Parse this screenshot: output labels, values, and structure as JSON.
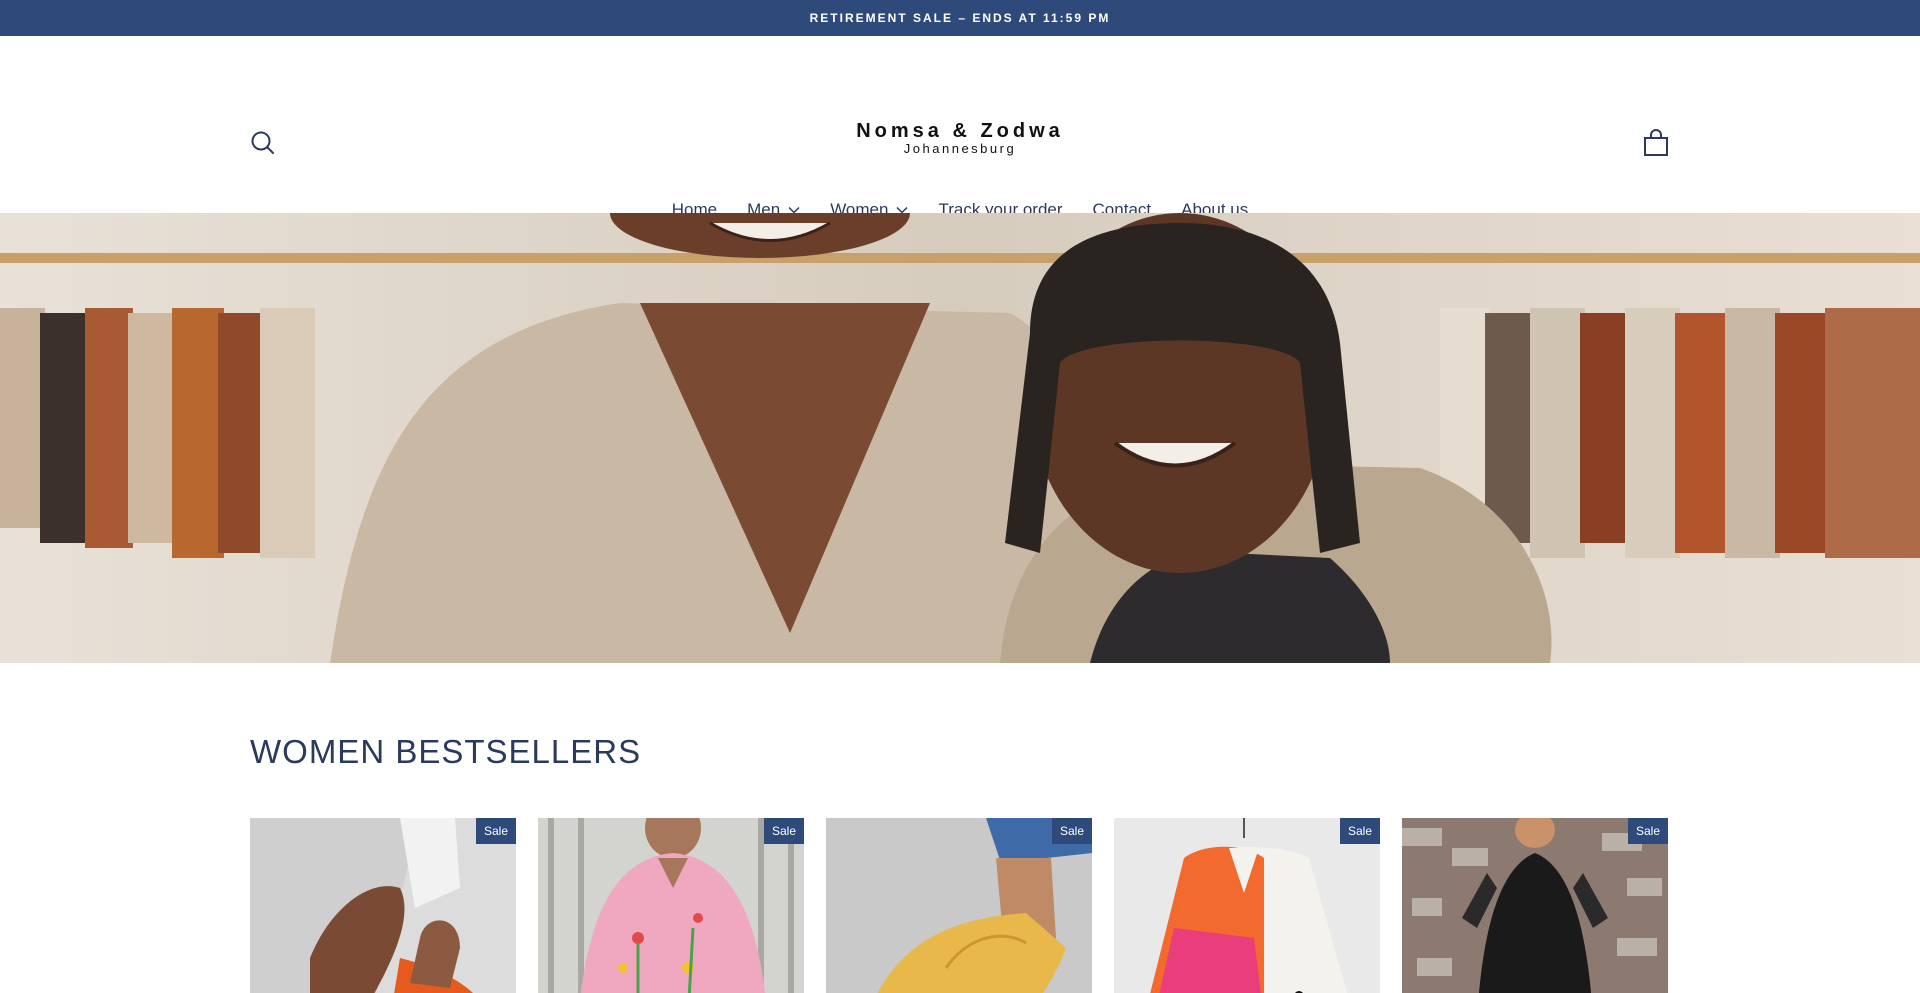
{
  "announcement": {
    "text": "RETIREMENT SALE – ENDS AT 11:59 PM"
  },
  "header": {
    "logo_name": "Nomsa & Zodwa",
    "logo_city": "Johannesburg",
    "search_icon": "search-icon",
    "cart_icon": "shopping-bag-icon"
  },
  "nav": {
    "items": [
      {
        "label": "Home"
      },
      {
        "label": "Men",
        "has_dropdown": true
      },
      {
        "label": "Women",
        "has_dropdown": true
      },
      {
        "label": "Track your order"
      },
      {
        "label": "Contact"
      },
      {
        "label": "About us"
      }
    ]
  },
  "section": {
    "title": "WOMEN BESTSELLERS"
  },
  "products": [
    {
      "badge": "Sale"
    },
    {
      "badge": "Sale"
    },
    {
      "badge": "Sale"
    },
    {
      "badge": "Sale"
    },
    {
      "badge": "Sale"
    }
  ],
  "colors": {
    "accent": "#2d4a7a",
    "text": "#2b3a5c",
    "background": "#ffffff"
  }
}
